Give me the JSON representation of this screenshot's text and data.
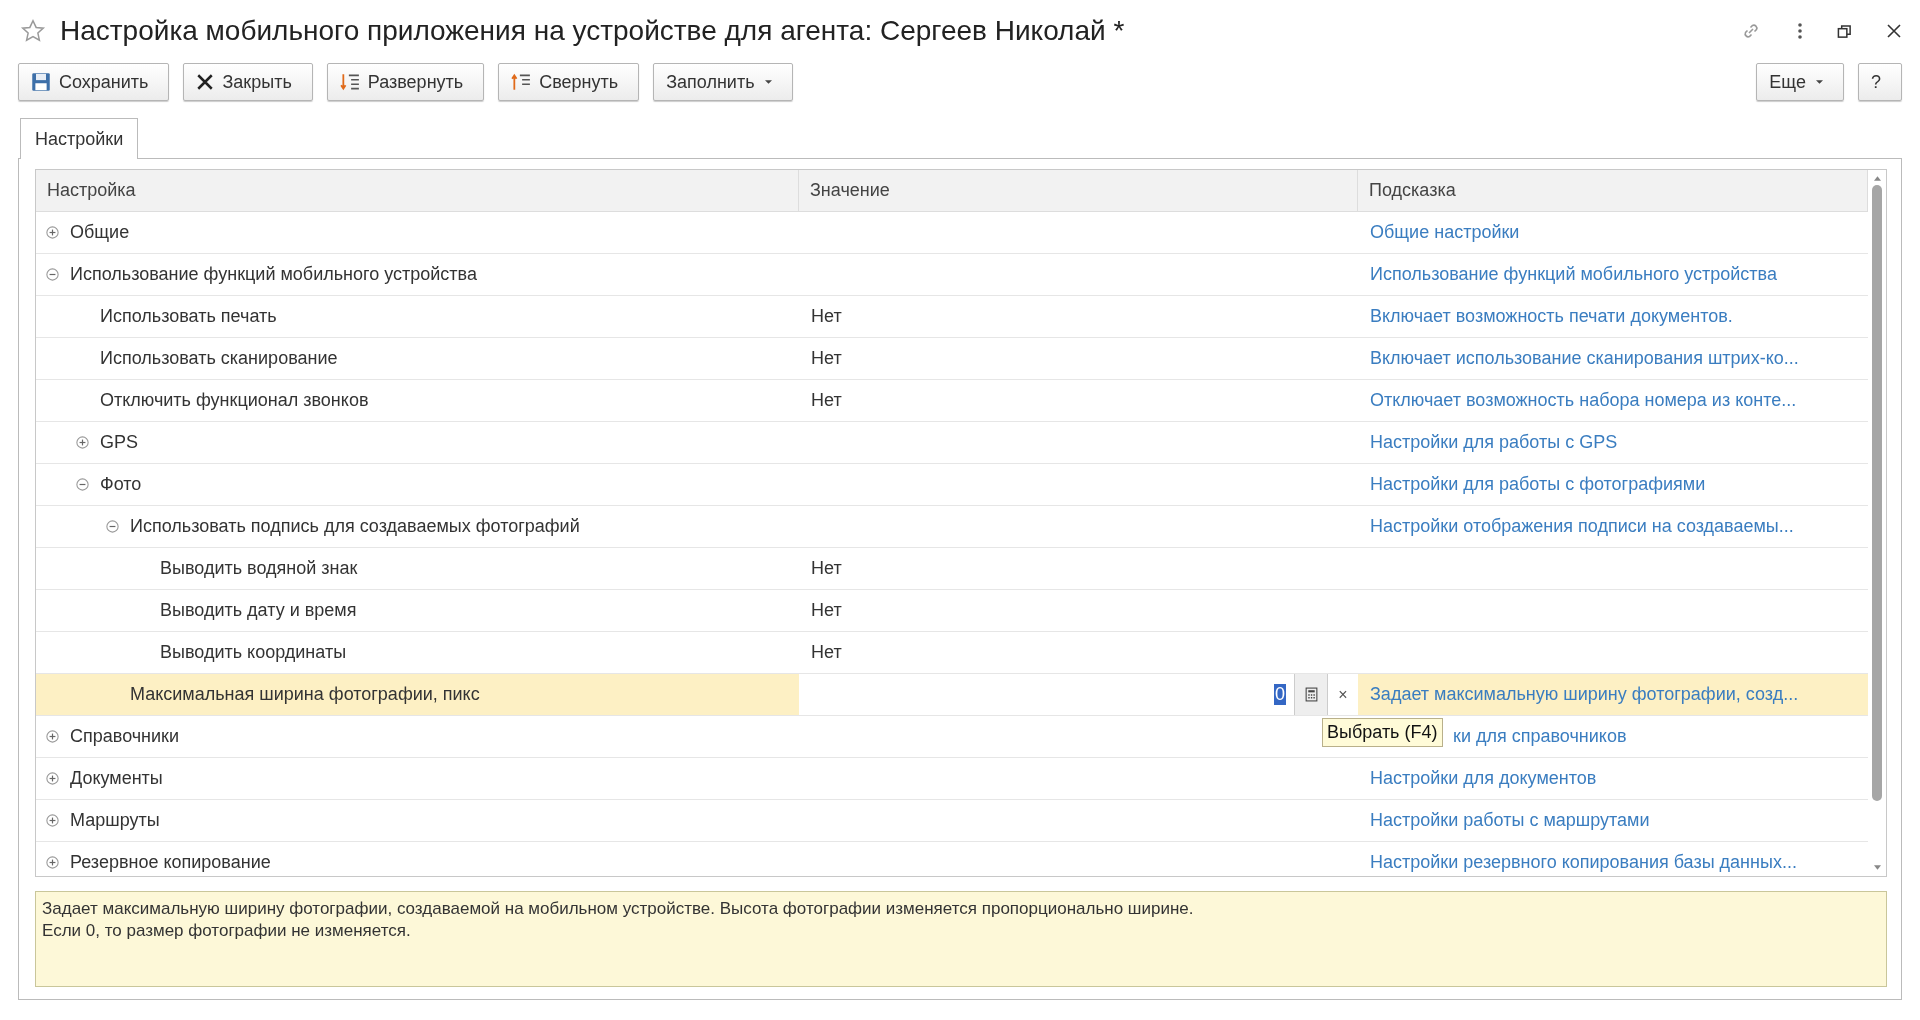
{
  "window": {
    "title": "Настройка мобильного приложения на устройстве для агента: Сергеев Николай *"
  },
  "toolbar": [
    {
      "label": "Сохранить",
      "kind": "save"
    },
    {
      "label": "Закрыть",
      "kind": "close"
    },
    {
      "label": "Развернуть",
      "kind": "expand"
    },
    {
      "label": "Свернуть",
      "kind": "collapse"
    },
    {
      "label": "Заполнить",
      "kind": "dropdown"
    }
  ],
  "toolbar_right": [
    {
      "label": "Еще",
      "kind": "dropdown"
    },
    {
      "label": "?",
      "kind": "plain"
    }
  ],
  "tabs": [
    {
      "label": "Настройки",
      "selected": true
    }
  ],
  "table": {
    "tooltip": "Выбрать (F4)",
    "columns": [
      "Настройка",
      "Значение",
      "Подсказка"
    ],
    "rows": [
      {
        "name": "Общие",
        "expanded": false,
        "selected": false,
        "hint": "Общие настройки"
      },
      {
        "name": "Использование функций мобильного устройства",
        "expanded": true,
        "selected": false,
        "hint": "Использование функций мобильного устройства",
        "children": [
          {
            "name": "Использовать печать",
            "value": "Нет",
            "selected": false,
            "hint": "Включает возможность печати документов."
          },
          {
            "name": "Использовать сканирование",
            "value": "Нет",
            "selected": false,
            "hint": "Включает использование сканирования штрих-ко..."
          },
          {
            "name": "Отключить функционал звонков",
            "value": "Нет",
            "selected": false,
            "hint": "Отключает возможность набора номера из конте..."
          },
          {
            "name": "GPS",
            "expanded": false,
            "selected": false,
            "hint": "Настройки для работы с GPS"
          },
          {
            "name": "Фото",
            "expanded": true,
            "selected": false,
            "hint": "Настройки для работы с фотографиями",
            "children": [
              {
                "name": "Использовать подпись для создаваемых фотографий",
                "expanded": true,
                "selected": false,
                "hint": "Настройки отображения подписи на создаваемы...",
                "children": [
                  {
                    "name": "Выводить водяной знак",
                    "value": "Нет",
                    "selected": false
                  },
                  {
                    "name": "Выводить дату и время",
                    "value": "Нет",
                    "selected": false
                  },
                  {
                    "name": "Выводить координаты",
                    "value": "Нет",
                    "selected": false
                  }
                ]
              },
              {
                "name": "Максимальная ширина фотографии, пикс",
                "selected": true,
                "field": {
                  "value": "0",
                  "clear": "×"
                },
                "hint": "Задает максимальную ширину фотографии, созд..."
              }
            ]
          }
        ]
      },
      {
        "name": "Справочники",
        "expanded": false,
        "selected": false,
        "hint": "ки для справочников",
        "hint_covered": true
      },
      {
        "name": "Документы",
        "expanded": false,
        "selected": false,
        "hint": "Настройки для документов"
      },
      {
        "name": "Маршруты",
        "expanded": false,
        "selected": false,
        "hint": "Настройки работы с маршрутами"
      },
      {
        "name": "Резервное копирование",
        "expanded": false,
        "selected": false,
        "hint": "Настройки резервного копирования базы данных..."
      }
    ]
  },
  "description": [
    "Задает максимальную ширину фотографии, создаваемой на мобильном устройстве. Высота фотографии изменяется пропорционально ширине.",
    "Если 0, то размер фотографии не изменяется."
  ]
}
